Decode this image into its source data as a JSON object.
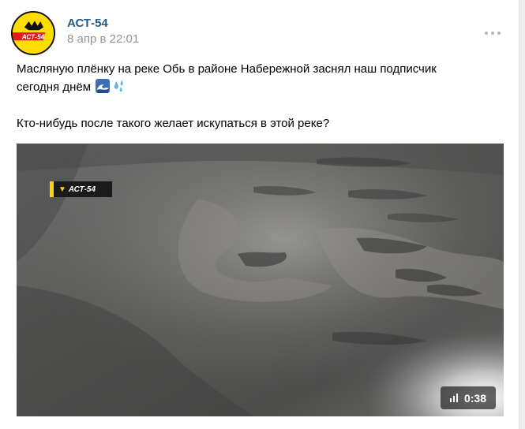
{
  "post": {
    "author": "АСТ-54",
    "date": "8 апр в 22:01",
    "text_line1": "Масляную плёнку на реке Обь в районе Набережной заснял наш подписчик",
    "text_line2": "сегодня днём",
    "text_line3": "Кто-нибудь после такого желает искупаться в этой реке?",
    "emoji_icons": [
      "wave-icon",
      "sweat-droplets-icon"
    ],
    "avatar_logo_text": "АСТ-54",
    "more_icon": "three-dots-icon"
  },
  "video": {
    "duration": "0:38",
    "watermark": "АСТ-54",
    "quality_icon": "signal-bars-icon"
  },
  "colors": {
    "link": "#2a5885",
    "muted": "#939393",
    "brand_yellow": "#ffdd00"
  }
}
